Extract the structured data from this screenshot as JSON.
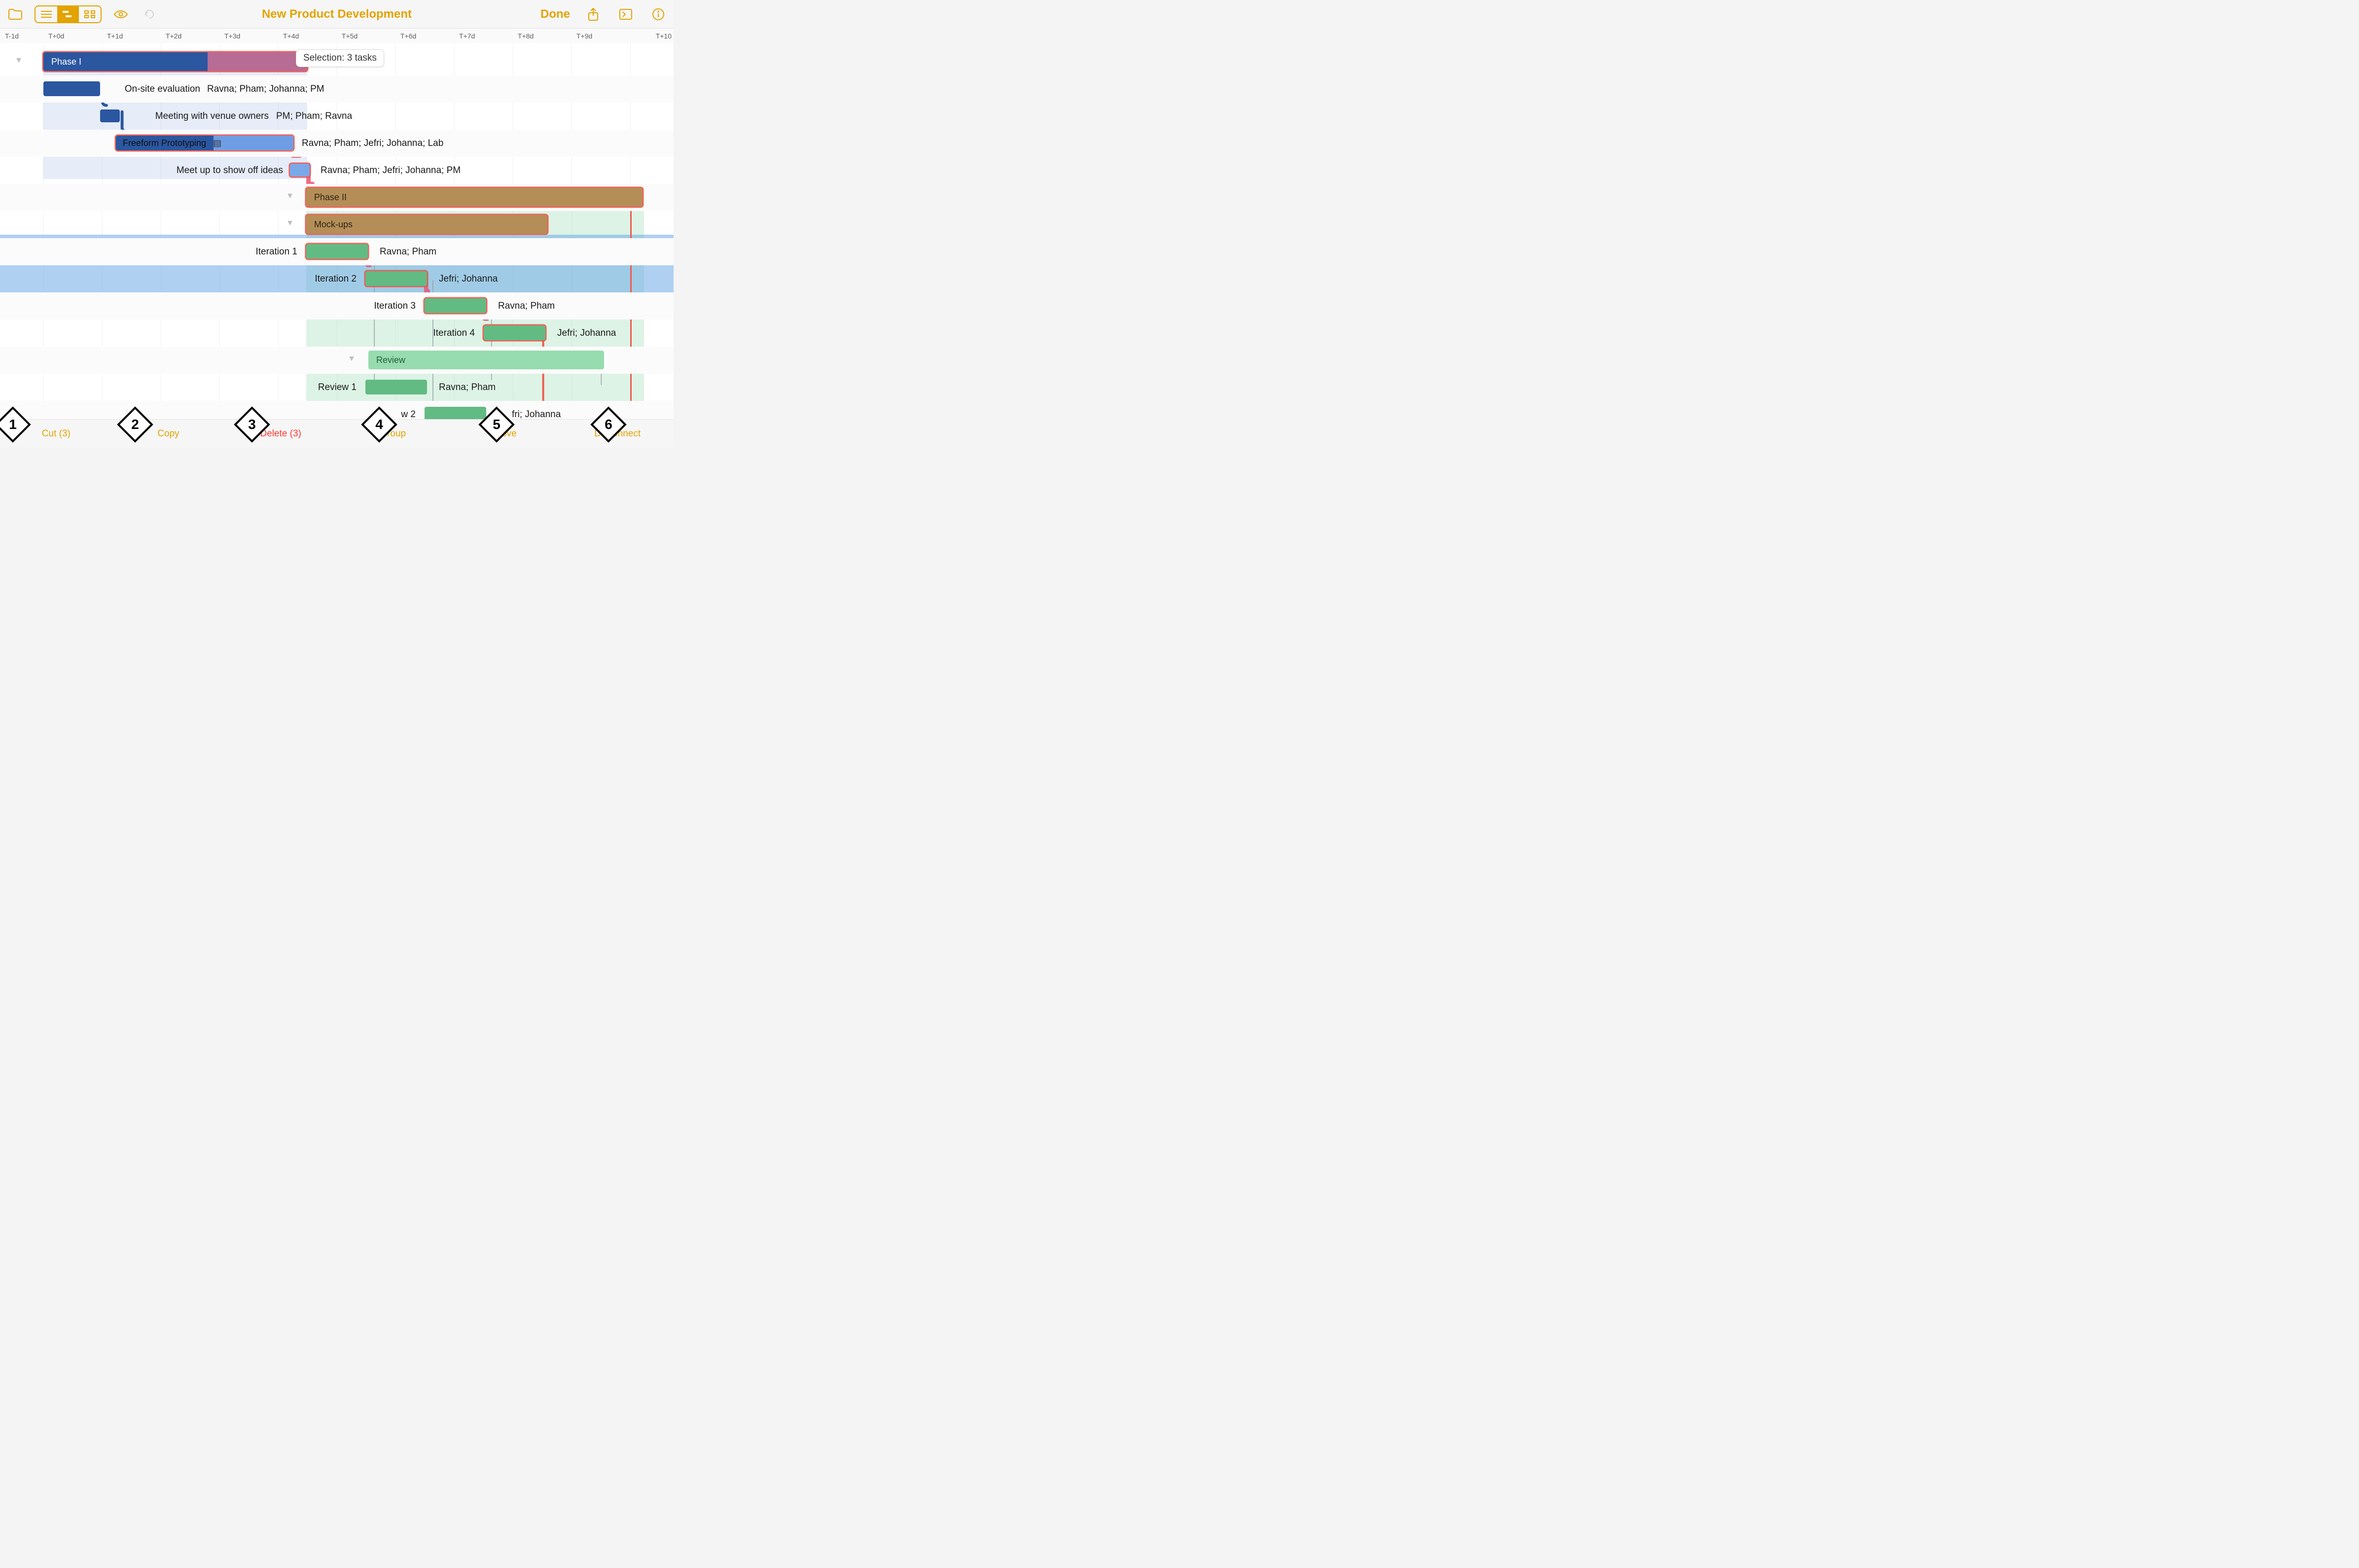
{
  "doc": {
    "title": "New Product Development"
  },
  "toolbar": {
    "done": "Done"
  },
  "timescale": [
    "T-1d",
    "T+0d",
    "T+1d",
    "T+2d",
    "T+3d",
    "T+4d",
    "T+5d",
    "T+6d",
    "T+7d",
    "T+8d",
    "T+9d",
    "T+10"
  ],
  "selection_tip": "Selection: 3 tasks",
  "rows": [
    {
      "kind": "summary",
      "label": "Phase I",
      "barL": 88,
      "barW": 535,
      "fillSplit": 333,
      "colorA": "#2b56a0",
      "colorB": "#b76c95",
      "sel": true
    },
    {
      "kind": "task",
      "leftLabel": "On-site evaluation",
      "leftLabelR": 406,
      "rightLabel": "Ravna; Pham; Johanna; PM",
      "rightLabelL": 420,
      "barL": 88,
      "barW": 115,
      "color": "#2b56a0",
      "small": false
    },
    {
      "kind": "task",
      "leftLabel": "Meeting with venue owners",
      "leftLabelR": 545,
      "rightLabel": "PM; Pham; Ravna",
      "rightLabelL": 560,
      "barL": 203,
      "barW": 40,
      "color": "#2b56a0",
      "small": true
    },
    {
      "kind": "task",
      "leftLabel": "",
      "barL": 235,
      "barW": 360,
      "color": "#2b56a0",
      "gradient": true,
      "barText": "Freeform Prototyping",
      "note": true,
      "rightLabel": "Ravna; Pham; Jefri; Johanna; Lab",
      "rightLabelL": 612,
      "sel": true
    },
    {
      "kind": "task",
      "leftLabel": "Meet up to show off ideas",
      "leftLabelR": 574,
      "barL": 588,
      "barW": 40,
      "color": "#7aa8e8",
      "rightLabel": "Ravna; Pham; Jefri; Johanna; PM",
      "rightLabelL": 650,
      "small": true,
      "sel": true
    },
    {
      "kind": "summary",
      "label": "Phase II",
      "barL": 621,
      "barW": 682,
      "colorA": "#b58e57",
      "sel": true,
      "disclose": true
    },
    {
      "kind": "summary",
      "label": "Mock-ups",
      "barL": 621,
      "barW": 489,
      "colorA": "#b58e57",
      "sel": true,
      "disclose": true
    },
    {
      "kind": "task",
      "leftLabel": "Iteration 1",
      "leftLabelR": 603,
      "barL": 621,
      "barW": 125,
      "color": "#62bb82",
      "rightLabel": "Ravna; Pham",
      "rightLabelL": 770,
      "sel": true,
      "hi": true
    },
    {
      "kind": "task",
      "leftLabel": "Iteration 2",
      "leftLabelR": 723,
      "barL": 741,
      "barW": 125,
      "color": "#62bb82",
      "rightLabel": "Jefri; Johanna",
      "rightLabelL": 890,
      "sel": true,
      "hi": true
    },
    {
      "kind": "task",
      "leftLabel": "Iteration 3",
      "leftLabelR": 843,
      "barL": 861,
      "barW": 125,
      "color": "#62bb82",
      "rightLabel": "Ravna; Pham",
      "rightLabelL": 1010,
      "sel": true,
      "hi": true
    },
    {
      "kind": "task",
      "leftLabel": "Iteration 4",
      "leftLabelR": 963,
      "barL": 981,
      "barW": 125,
      "color": "#62bb82",
      "rightLabel": "Jefri; Johanna",
      "rightLabelL": 1130,
      "sel": true
    },
    {
      "kind": "summary",
      "label": "Review",
      "barL": 747,
      "barW": 478,
      "colorA": "#97dcae",
      "disclose": true,
      "light": true
    },
    {
      "kind": "task",
      "leftLabel": "Review 1",
      "leftLabelR": 723,
      "barL": 741,
      "barW": 125,
      "color": "#62bb82",
      "rightLabel": "Ravna; Pham",
      "rightLabelL": 890
    },
    {
      "kind": "task",
      "leftLabel": "w 2",
      "leftLabelR": 843,
      "barL": 861,
      "barW": 125,
      "color": "#62bb82",
      "rightLabel": "fri; Johanna",
      "rightLabelL": 1038,
      "partial": true
    }
  ],
  "actions": [
    {
      "label": "Cut (3)",
      "num": "1"
    },
    {
      "label": "Copy",
      "num": "2"
    },
    {
      "label": "Delete (3)",
      "num": "3",
      "danger": true
    },
    {
      "label": "Group",
      "num": "4"
    },
    {
      "label": "Move",
      "num": "5"
    },
    {
      "label": "Disconnect",
      "num": "6"
    }
  ],
  "colors": {
    "accent": "#e3a300"
  }
}
